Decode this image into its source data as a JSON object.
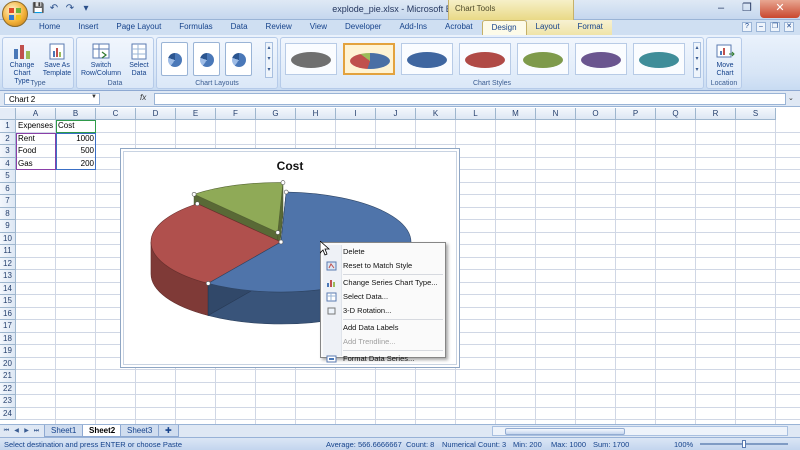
{
  "window": {
    "title": "explode_pie.xlsx - Microsoft Excel",
    "context_tab_group": "Chart Tools"
  },
  "ribbon": {
    "tabs": [
      "Home",
      "Insert",
      "Page Layout",
      "Formulas",
      "Data",
      "Review",
      "View",
      "Developer",
      "Add-Ins",
      "Acrobat",
      "Design",
      "Layout",
      "Format"
    ],
    "active_tab": "Design",
    "groups": {
      "type": {
        "label": "Type",
        "change_chart_type": "Change Chart Type",
        "save_as_template": "Save As Template"
      },
      "data": {
        "label": "Data",
        "switch_row_column": "Switch Row/Column",
        "select_data": "Select Data"
      },
      "chart_layouts": {
        "label": "Chart Layouts"
      },
      "chart_styles": {
        "label": "Chart Styles",
        "style_colors": [
          "#6f6f6f",
          "#4a6fa5",
          "#3f66a0",
          "#b04a46",
          "#7e9a4b",
          "#6a558f",
          "#3f8d99"
        ]
      },
      "location": {
        "label": "Location",
        "move_chart": "Move Chart"
      }
    }
  },
  "formula_bar": {
    "name_box": "Chart 2",
    "fx": "fx",
    "value": ""
  },
  "sheet": {
    "columns": [
      "A",
      "B",
      "C",
      "D",
      "E",
      "F",
      "G",
      "H",
      "I",
      "J",
      "K",
      "L",
      "M",
      "N",
      "O",
      "P",
      "Q",
      "R",
      "S"
    ],
    "rows": [
      "1",
      "2",
      "3",
      "4",
      "5",
      "6",
      "7",
      "8",
      "9",
      "10",
      "11",
      "12",
      "13",
      "14",
      "15",
      "16",
      "17",
      "18",
      "19",
      "20",
      "21",
      "22",
      "23",
      "24"
    ],
    "cells": {
      "A1": "Expenses",
      "B1": "Cost",
      "A2": "Rent",
      "B2": "1000",
      "A3": "Food",
      "B3": "500",
      "A4": "Gas",
      "B4": "200"
    }
  },
  "chart": {
    "title": "Cost",
    "colors": {
      "rent": "#4f74aa",
      "food": "#b0504d",
      "gas": "#8faa57"
    }
  },
  "chart_data": {
    "type": "pie",
    "title": "Cost",
    "categories": [
      "Rent",
      "Food",
      "Gas"
    ],
    "values": [
      1000,
      500,
      200
    ],
    "exploded": "Gas"
  },
  "context_menu": {
    "items": [
      {
        "label": "Delete",
        "enabled": true
      },
      {
        "label": "Reset to Match Style",
        "enabled": true
      },
      {
        "label": "Change Series Chart Type...",
        "enabled": true
      },
      {
        "label": "Select Data...",
        "enabled": true
      },
      {
        "label": "3-D Rotation...",
        "enabled": true
      },
      {
        "label": "Add Data Labels",
        "enabled": true
      },
      {
        "label": "Add Trendline...",
        "enabled": false
      },
      {
        "label": "Format Data Series...",
        "enabled": true
      }
    ]
  },
  "sheet_tabs": {
    "tabs": [
      "Sheet1",
      "Sheet2",
      "Sheet3"
    ],
    "active": "Sheet2"
  },
  "status_bar": {
    "message": "Select destination and press ENTER or choose Paste",
    "average": "Average: 566.6666667",
    "count": "Count: 8",
    "numerical_count": "Numerical Count: 3",
    "min": "Min: 200",
    "max": "Max: 1000",
    "sum": "Sum: 1700",
    "zoom": "100%"
  }
}
